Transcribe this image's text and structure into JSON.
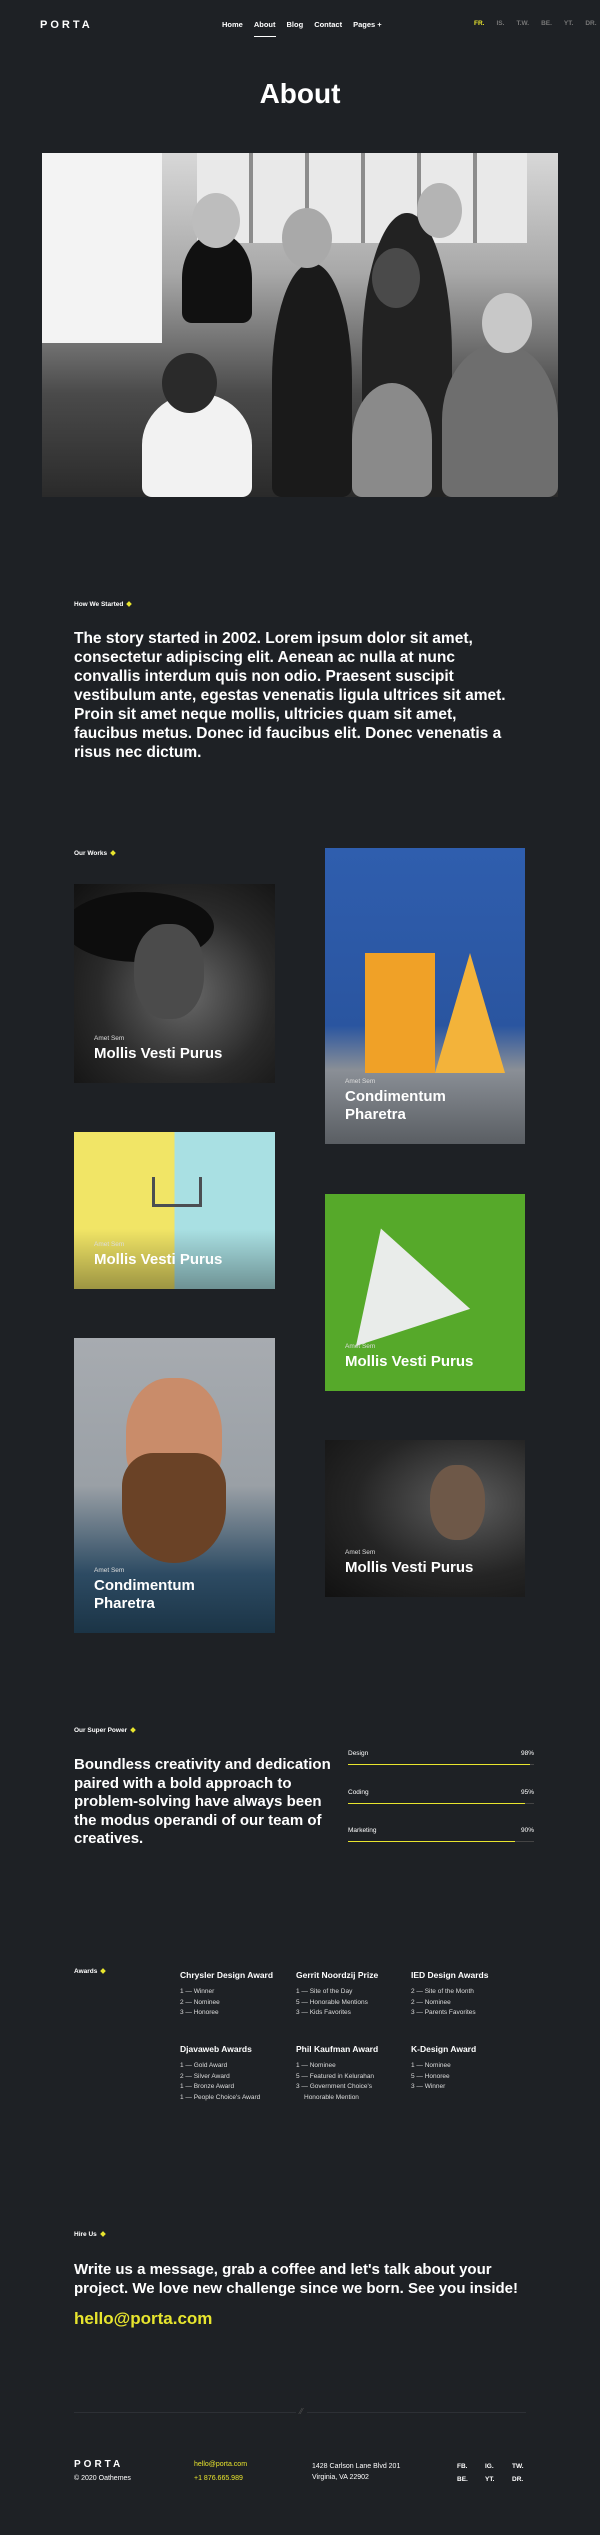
{
  "header": {
    "logo": "PORTA",
    "nav": [
      "Home",
      "About",
      "Blog",
      "Contact",
      "Pages +"
    ],
    "langs": [
      "FR.",
      "IS.",
      "T.W.",
      "BE.",
      "YT.",
      "DR."
    ]
  },
  "page_title": "About",
  "story": {
    "label": "How We Started",
    "text": "The story started in 2002. Lorem ipsum dolor sit amet, consectetur adipiscing elit. Aenean ac nulla at nunc convallis interdum quis non odio. Praesent suscipit vestibulum ante, egestas venenatis ligula ultrices sit amet. Proin sit amet neque mollis, ultricies quam sit amet, faucibus metus. Donec id faucibus elit. Donec venenatis a risus nec dictum."
  },
  "works": {
    "label": "Our Works",
    "items": [
      {
        "sub": "Amet Sem",
        "title": "Mollis Vesti Purus"
      },
      {
        "sub": "Amet Sem",
        "title": "Condimentum Pharetra"
      },
      {
        "sub": "Amet Sem",
        "title": "Mollis Vesti Purus"
      },
      {
        "sub": "Amet Sem",
        "title": "Mollis Vesti Purus"
      },
      {
        "sub": "Amet Sem",
        "title": "Condimentum Pharetra"
      },
      {
        "sub": "Amet Sem",
        "title": "Mollis Vesti Purus"
      }
    ]
  },
  "power": {
    "label": "Our Super Power",
    "text": "Boundless creativity and dedication paired with a bold approach to problem-solving have always been the modus operandi of our team of creatives.",
    "bars": [
      {
        "name": "Design",
        "value": "98%",
        "fill": 0.98
      },
      {
        "name": "Coding",
        "value": "95%",
        "fill": 0.95
      },
      {
        "name": "Marketing",
        "value": "90%",
        "fill": 0.9
      }
    ]
  },
  "awards": {
    "label": "Awards",
    "groups": [
      {
        "title": "Chrysler Design Award",
        "items": [
          "1 — Winner",
          "2 — Nominee",
          "3 — Honoree"
        ]
      },
      {
        "title": "Gerrit Noordzij Prize",
        "items": [
          "1 — Site of the Day",
          "5 — Honorable Mentions",
          "3 — Kids Favorites"
        ]
      },
      {
        "title": "IED Design Awards",
        "items": [
          "2 — Site of the Month",
          "2 — Nominee",
          "3 — Parents Favorites"
        ]
      },
      {
        "title": "Djavaweb Awards",
        "items": [
          "1 — Gold Award",
          "2 — Silver Award",
          "1 — Bronze Award",
          "1 — People Choice's Award"
        ]
      },
      {
        "title": "Phil Kaufman Award",
        "items": [
          "1 — Nominee",
          "5 — Featured in Kelurahan",
          "3 — Government Choice's",
          "Honorable Mention"
        ]
      },
      {
        "title": "K-Design Award",
        "items": [
          "1 — Nominee",
          "5 — Honoree",
          "3 — Winner"
        ]
      }
    ]
  },
  "hire": {
    "label": "Hire Us",
    "text": "Write us a message, grab a coffee and let's talk about your project. We love new challenge since we born. See you inside!",
    "email": "hello@porta.com"
  },
  "footer": {
    "logo": "PORTA",
    "copyright": "© 2020 Oathemes",
    "email": "hello@porta.com",
    "phone": "+1 876.665.989",
    "address1": "1428 Carlson Lane Blvd 201",
    "address2": "Virginia, VA 22902",
    "social": [
      "FB.",
      "IG.",
      "TW.",
      "BE.",
      "YT.",
      "DR."
    ]
  },
  "colors": {
    "accent": "#e8e52e",
    "background": "#1e2125"
  }
}
